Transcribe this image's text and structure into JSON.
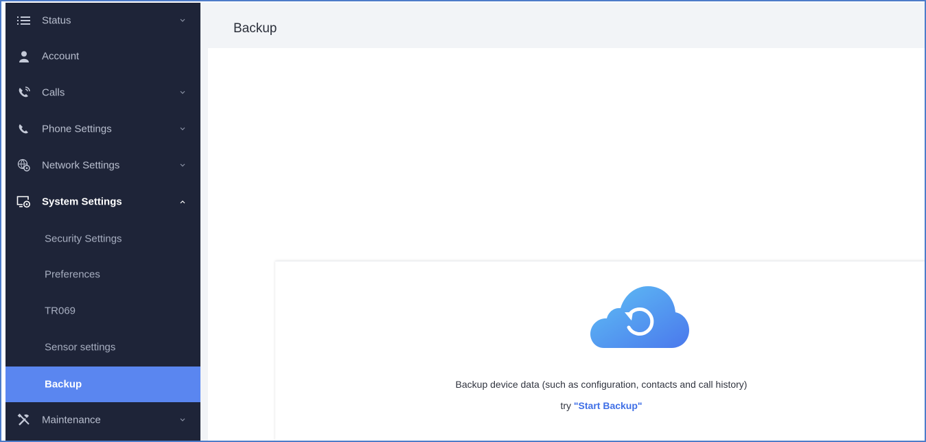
{
  "sidebar": {
    "items": [
      {
        "label": "Status",
        "icon": "list-icon"
      },
      {
        "label": "Account",
        "icon": "user-icon"
      },
      {
        "label": "Calls",
        "icon": "phone-ring-icon"
      },
      {
        "label": "Phone Settings",
        "icon": "phone-icon"
      },
      {
        "label": "Network Settings",
        "icon": "globe-gear-icon"
      },
      {
        "label": "System Settings",
        "icon": "monitor-gear-icon"
      },
      {
        "label": "Maintenance",
        "icon": "tools-icon"
      }
    ],
    "sub_items": [
      {
        "label": "Security Settings"
      },
      {
        "label": "Preferences"
      },
      {
        "label": "TR069"
      },
      {
        "label": "Sensor settings"
      },
      {
        "label": "Backup"
      }
    ]
  },
  "header": {
    "title": "Backup"
  },
  "backup_card": {
    "description": "Backup device data (such as configuration, contacts and call history)",
    "try_prefix": "try ",
    "try_link": "\"Start Backup\""
  },
  "colors": {
    "sidebar_bg": "#1e2438",
    "active_item": "#5a86f0",
    "link": "#3f6fe6",
    "cloud_top": "#5fc0f5",
    "cloud_bottom": "#4a78ec"
  }
}
